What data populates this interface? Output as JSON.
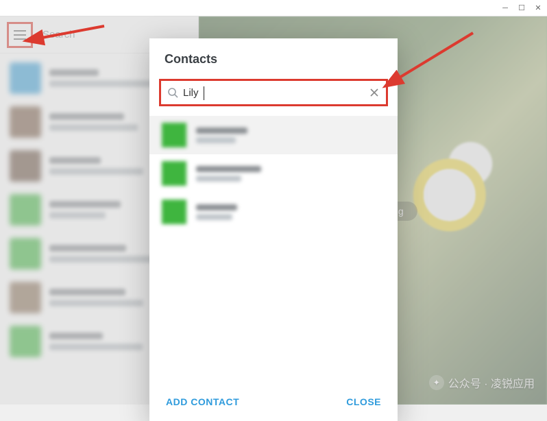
{
  "window": {
    "search_placeholder": "Search"
  },
  "dialog": {
    "title": "Contacts",
    "search_value": "Lily",
    "add_contact_label": "ADD CONTACT",
    "close_label": "CLOSE"
  },
  "banner": {
    "text": "messaging"
  },
  "watermark": {
    "text": "公众号 · 凌锐应用"
  },
  "chats": [
    {
      "avatar_color": "#3aa0d8"
    },
    {
      "avatar_color": "#7a5c47"
    },
    {
      "avatar_color": "#6b5242"
    },
    {
      "avatar_color": "#3fb53f"
    },
    {
      "avatar_color": "#3fb53f"
    },
    {
      "avatar_color": "#8a7158"
    },
    {
      "avatar_color": "#3fb53f"
    }
  ],
  "results": [
    {},
    {},
    {}
  ]
}
